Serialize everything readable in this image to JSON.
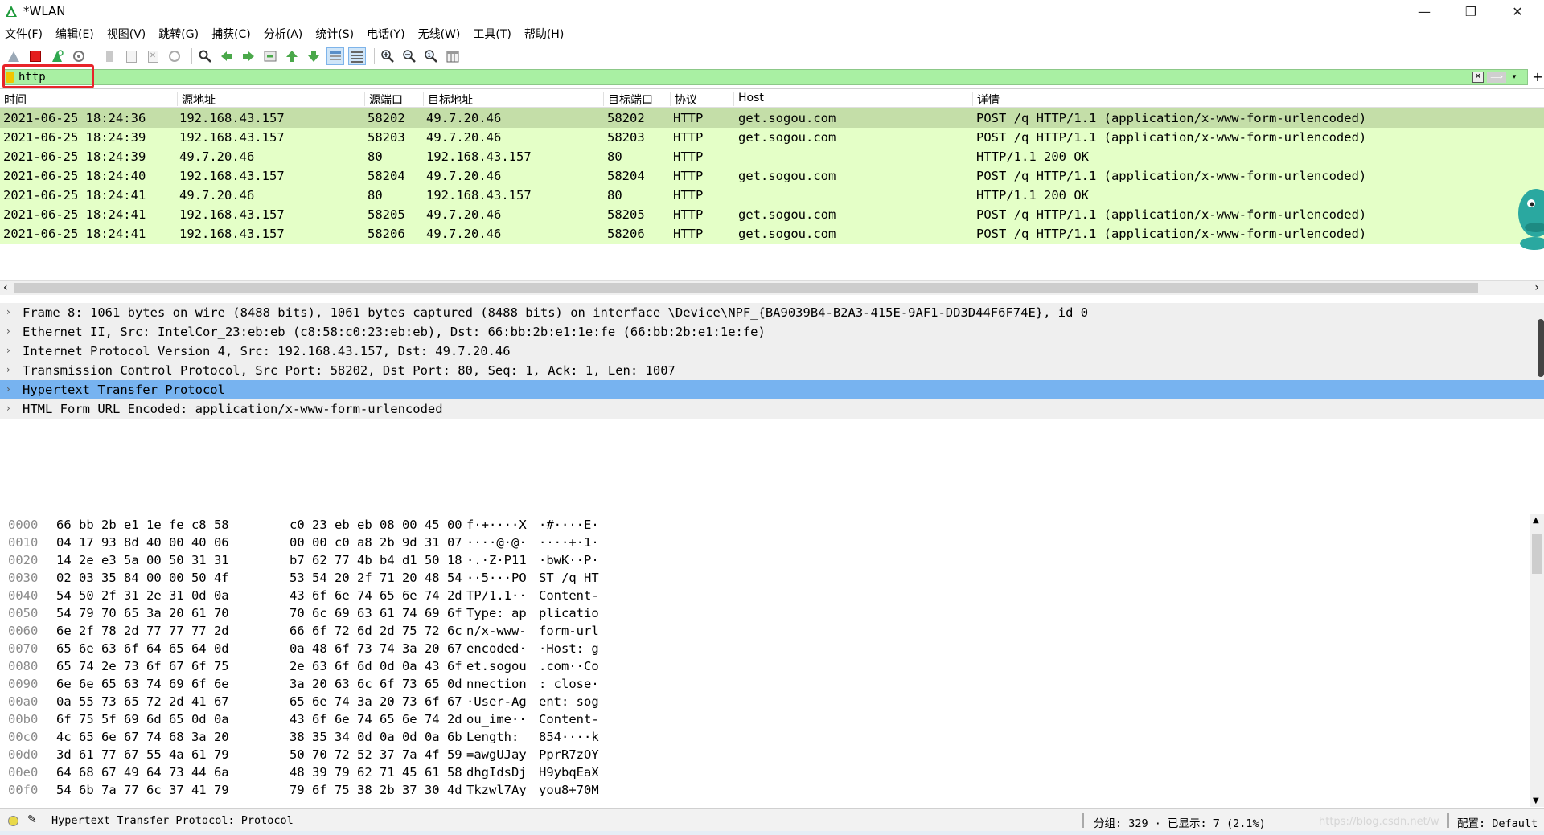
{
  "window": {
    "title": "*WLAN",
    "minimize": "—",
    "restore": "❐",
    "close": "✕"
  },
  "menu": [
    "文件(F)",
    "编辑(E)",
    "视图(V)",
    "跳转(G)",
    "捕获(C)",
    "分析(A)",
    "统计(S)",
    "电话(Y)",
    "无线(W)",
    "工具(T)",
    "帮助(H)"
  ],
  "toolbar_icons": [
    "shark-fin-start-icon",
    "stop-capture-icon",
    "restart-capture-icon",
    "capture-options-icon",
    "open-file-icon",
    "save-file-icon",
    "close-file-icon",
    "reload-file-icon",
    "find-packet-icon",
    "go-back-icon",
    "go-forward-icon",
    "go-to-packet-icon",
    "first-packet-icon",
    "last-packet-icon",
    "autoscroll-icon",
    "colorize-icon",
    "zoom-in-icon",
    "zoom-out-icon",
    "zoom-normal-icon",
    "resize-columns-icon"
  ],
  "filter": {
    "value": "http"
  },
  "packet_list": {
    "columns": [
      "时间",
      "源地址",
      "源端口",
      "目标地址",
      "目标端口",
      "协议",
      "Host",
      "详情"
    ],
    "rows": [
      [
        "2021-06-25 18:24:36",
        "192.168.43.157",
        "58202",
        "49.7.20.46",
        "58202",
        "HTTP",
        "get.sogou.com",
        "POST /q HTTP/1.1  (application/x-www-form-urlencoded)"
      ],
      [
        "2021-06-25 18:24:39",
        "192.168.43.157",
        "58203",
        "49.7.20.46",
        "58203",
        "HTTP",
        "get.sogou.com",
        "POST /q HTTP/1.1  (application/x-www-form-urlencoded)"
      ],
      [
        "2021-06-25 18:24:39",
        "49.7.20.46",
        "80",
        "192.168.43.157",
        "80",
        "HTTP",
        "",
        "HTTP/1.1 200 OK"
      ],
      [
        "2021-06-25 18:24:40",
        "192.168.43.157",
        "58204",
        "49.7.20.46",
        "58204",
        "HTTP",
        "get.sogou.com",
        "POST /q HTTP/1.1  (application/x-www-form-urlencoded)"
      ],
      [
        "2021-06-25 18:24:41",
        "49.7.20.46",
        "80",
        "192.168.43.157",
        "80",
        "HTTP",
        "",
        "HTTP/1.1 200 OK"
      ],
      [
        "2021-06-25 18:24:41",
        "192.168.43.157",
        "58205",
        "49.7.20.46",
        "58205",
        "HTTP",
        "get.sogou.com",
        "POST /q HTTP/1.1  (application/x-www-form-urlencoded)"
      ],
      [
        "2021-06-25 18:24:41",
        "192.168.43.157",
        "58206",
        "49.7.20.46",
        "58206",
        "HTTP",
        "get.sogou.com",
        "POST /q HTTP/1.1  (application/x-www-form-urlencoded)"
      ]
    ],
    "selected_row": 0
  },
  "details": {
    "rows": [
      "Frame 8: 1061 bytes on wire (8488 bits), 1061 bytes captured (8488 bits) on interface \\Device\\NPF_{BA9039B4-B2A3-415E-9AF1-DD3D44F6F74E}, id 0",
      "Ethernet II, Src: IntelCor_23:eb:eb (c8:58:c0:23:eb:eb), Dst: 66:bb:2b:e1:1e:fe (66:bb:2b:e1:1e:fe)",
      "Internet Protocol Version 4, Src: 192.168.43.157, Dst: 49.7.20.46",
      "Transmission Control Protocol, Src Port: 58202, Dst Port: 80, Seq: 1, Ack: 1, Len: 1007",
      "Hypertext Transfer Protocol",
      "HTML Form URL Encoded: application/x-www-form-urlencoded"
    ],
    "selected_row": 4,
    "expander": "›"
  },
  "bytes": {
    "rows": [
      [
        "0000",
        "66 bb 2b e1 1e fe c8 58",
        "c0 23 eb eb 08 00 45 00",
        "f·+····X",
        "·#····E·"
      ],
      [
        "0010",
        "04 17 93 8d 40 00 40 06",
        "00 00 c0 a8 2b 9d 31 07",
        "····@·@·",
        "····+·1·"
      ],
      [
        "0020",
        "14 2e e3 5a 00 50 31 31",
        "b7 62 77 4b b4 d1 50 18",
        "·.·Z·P11",
        "·bwK··P·"
      ],
      [
        "0030",
        "02 03 35 84 00 00 50 4f",
        "53 54 20 2f 71 20 48 54",
        "··5···PO",
        "ST /q HT"
      ],
      [
        "0040",
        "54 50 2f 31 2e 31 0d 0a",
        "43 6f 6e 74 65 6e 74 2d",
        "TP/1.1··",
        "Content-"
      ],
      [
        "0050",
        "54 79 70 65 3a 20 61 70",
        "70 6c 69 63 61 74 69 6f",
        "Type: ap",
        "plicatio"
      ],
      [
        "0060",
        "6e 2f 78 2d 77 77 77 2d",
        "66 6f 72 6d 2d 75 72 6c",
        "n/x-www-",
        "form-url"
      ],
      [
        "0070",
        "65 6e 63 6f 64 65 64 0d",
        "0a 48 6f 73 74 3a 20 67",
        "encoded·",
        "·Host: g"
      ],
      [
        "0080",
        "65 74 2e 73 6f 67 6f 75",
        "2e 63 6f 6d 0d 0a 43 6f",
        "et.sogou",
        ".com··Co"
      ],
      [
        "0090",
        "6e 6e 65 63 74 69 6f 6e",
        "3a 20 63 6c 6f 73 65 0d",
        "nnection",
        ": close·"
      ],
      [
        "00a0",
        "0a 55 73 65 72 2d 41 67",
        "65 6e 74 3a 20 73 6f 67",
        "·User-Ag",
        "ent: sog"
      ],
      [
        "00b0",
        "6f 75 5f 69 6d 65 0d 0a",
        "43 6f 6e 74 65 6e 74 2d",
        "ou_ime··",
        "Content-"
      ],
      [
        "00c0",
        "4c 65 6e 67 74 68 3a 20",
        "38 35 34 0d 0a 0d 0a 6b",
        "Length: ",
        "854····k"
      ],
      [
        "00d0",
        "3d 61 77 67 55 4a 61 79",
        "50 70 72 52 37 7a 4f 59",
        "=awgUJay",
        "PprR7zOY"
      ],
      [
        "00e0",
        "64 68 67 49 64 73 44 6a",
        "48 39 79 62 71 45 61 58",
        "dhgIdsDj",
        "H9ybqEaX"
      ],
      [
        "00f0",
        "54 6b 7a 77 6c 37 41 79",
        "79 6f 75 38 2b 37 30 4d",
        "Tkzwl7Ay",
        "you8+70M"
      ]
    ]
  },
  "status": {
    "field_text": "Hypertext Transfer Protocol: Protocol",
    "stats": "分组: 329 · 已显示: 7 (2.1%)",
    "watermark": "https://blog.csdn.net/w",
    "profile": "配置: Default"
  },
  "colors": {
    "filter_bg": "#a9f0a3",
    "row_bg": "#e4ffc7",
    "row_selected": "#c4dea8",
    "detail_selected": "#77b3f0",
    "highlight_box": "#e8242a"
  }
}
